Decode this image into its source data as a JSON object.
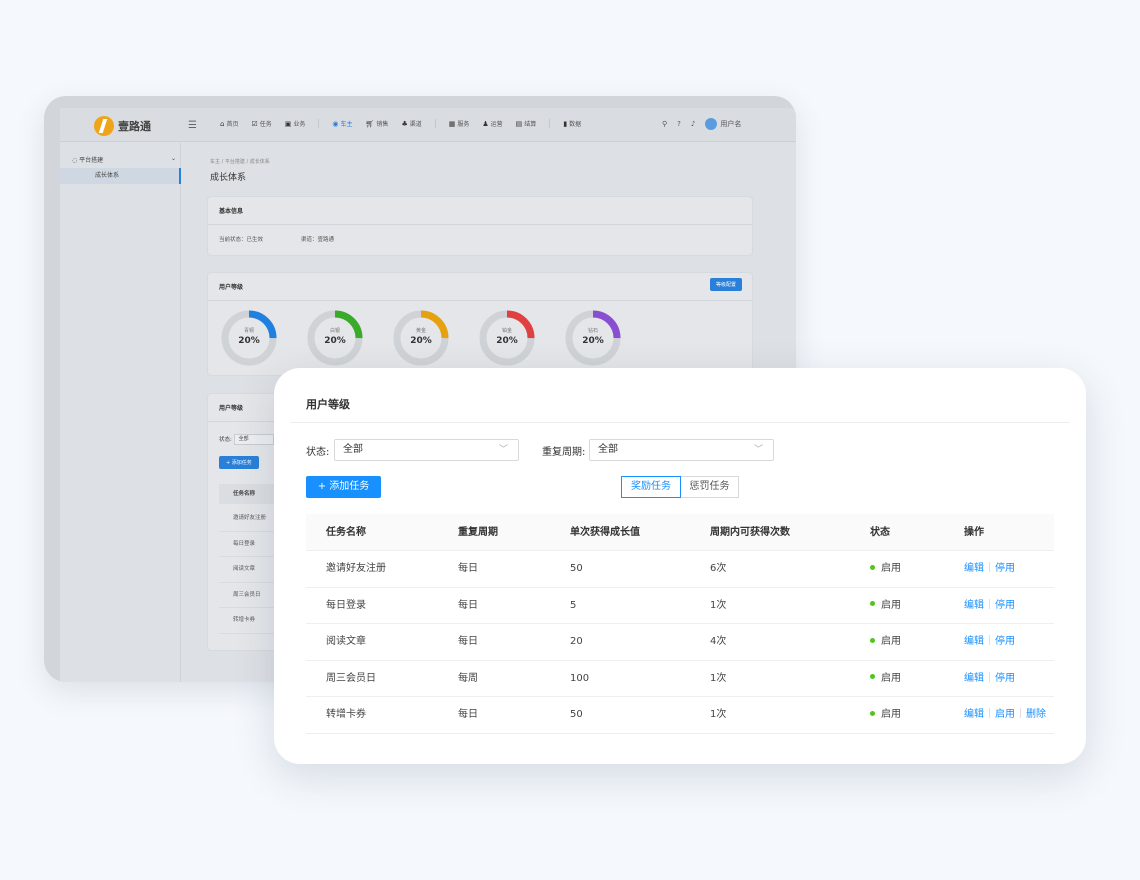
{
  "background_app": {
    "logo_text": "壹路通",
    "nav": [
      {
        "label": "首页",
        "icon": "home-icon"
      },
      {
        "label": "任务",
        "icon": "task-icon"
      },
      {
        "label": "业务",
        "icon": "briefcase-icon"
      },
      {
        "label": "车主",
        "icon": "car-owner-icon",
        "active": true
      },
      {
        "label": "销售",
        "icon": "cart-icon"
      },
      {
        "label": "渠道",
        "icon": "channel-icon"
      },
      {
        "label": "服务",
        "icon": "grid-icon"
      },
      {
        "label": "运营",
        "icon": "users-icon"
      },
      {
        "label": "结算",
        "icon": "settlement-icon"
      },
      {
        "label": "数据",
        "icon": "bar-chart-icon"
      }
    ],
    "user_name": "用户名",
    "sidebar": {
      "group_label": "平台搭建",
      "items": [
        {
          "label": "成长体系",
          "active": true
        }
      ]
    },
    "breadcrumb": [
      "车主",
      "平台搭建",
      "成长体系"
    ],
    "page_title": "成长体系",
    "basic_info": {
      "title": "基本信息",
      "status": "当前状态：已生效",
      "channel": "渠道：壹路通"
    },
    "user_levels": {
      "title": "用户等级",
      "config_button": "等级配置",
      "levels": [
        {
          "name": "青铜",
          "percent": "20%",
          "color": "#1f80e0"
        },
        {
          "name": "白银",
          "percent": "20%",
          "color": "#3aaa2a"
        },
        {
          "name": "黄金",
          "percent": "20%",
          "color": "#e5a10f"
        },
        {
          "name": "铂金",
          "percent": "20%",
          "color": "#e04040"
        },
        {
          "name": "钻石",
          "percent": "20%",
          "color": "#8a4fd0"
        }
      ]
    },
    "task_panel": {
      "title": "用户等级",
      "status_filter_label": "状态:",
      "status_filter_value": "全部",
      "add_button": "+ 添加任务",
      "column_header": "任务名称",
      "rows": [
        "邀请好友注册",
        "每日登录",
        "阅读文章",
        "周三会员日",
        "转增卡券"
      ]
    }
  },
  "foreground": {
    "title": "用户等级",
    "filters": {
      "status_label": "状态:",
      "status_value": "全部",
      "period_label": "重复周期:",
      "period_value": "全部"
    },
    "add_button": "+ 添加任务",
    "tabs": [
      {
        "label": "奖励任务",
        "active": true
      },
      {
        "label": "惩罚任务",
        "active": false
      }
    ],
    "table": {
      "columns": [
        "任务名称",
        "重复周期",
        "单次获得成长值",
        "周期内可获得次数",
        "状态",
        "操作"
      ],
      "rows": [
        {
          "name": "邀请好友注册",
          "period": "每日",
          "growth": "50",
          "times": "6次",
          "status": "启用",
          "actions": [
            "编辑",
            "停用"
          ]
        },
        {
          "name": "每日登录",
          "period": "每日",
          "growth": "5",
          "times": "1次",
          "status": "启用",
          "actions": [
            "编辑",
            "停用"
          ]
        },
        {
          "name": "阅读文章",
          "period": "每日",
          "growth": "20",
          "times": "4次",
          "status": "启用",
          "actions": [
            "编辑",
            "停用"
          ]
        },
        {
          "name": "周三会员日",
          "period": "每周",
          "growth": "100",
          "times": "1次",
          "status": "启用",
          "actions": [
            "编辑",
            "停用"
          ]
        },
        {
          "name": "转增卡券",
          "period": "每日",
          "growth": "50",
          "times": "1次",
          "status": "启用",
          "actions": [
            "编辑",
            "启用",
            "删除"
          ]
        }
      ]
    }
  }
}
